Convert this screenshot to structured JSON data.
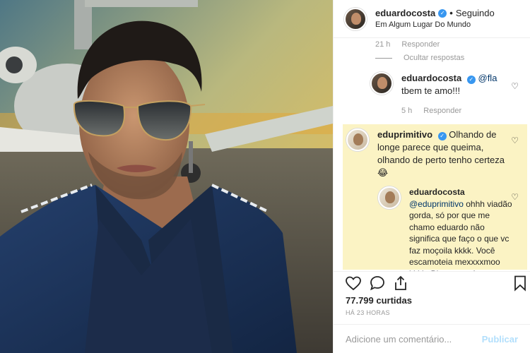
{
  "header": {
    "username": "eduardocosta",
    "follow_status": "Seguindo",
    "location": "Em Algum Lugar Do Mundo"
  },
  "top_meta": {
    "time": "21 h",
    "reply_label": "Responder"
  },
  "hide_replies_label": "Ocultar respostas",
  "reply1": {
    "username": "eduardocosta",
    "mention": "@fla",
    "text": "tbem te amo!!!",
    "time": "5 h",
    "reply_label": "Responder"
  },
  "comment2": {
    "username": "eduprimitivo",
    "text": "Olhando de longe parece que queima, olhando de perto tenho certeza 😂"
  },
  "reply2": {
    "username": "eduardocosta",
    "mention": "@eduprimitivo",
    "text": "ohhh viadão gorda, só por que me chamo eduardo não significa que faço o que vc faz moçoila kkkk. Você escamoteia mexxxxmoo kkkk. Bjuuuu xará"
  },
  "likes": "77.799 curtidas",
  "posted_ago": "HÁ 23 HORAS",
  "add_comment": {
    "placeholder": "Adicione um comentário...",
    "publish_label": "Publicar"
  },
  "colors": {
    "verified": "#3897f0",
    "highlight": "#fbf3c4",
    "publish_disabled": "#b2dffc",
    "meta_gray": "#999999"
  },
  "icons": [
    "heart-icon",
    "comment-icon",
    "share-icon",
    "bookmark-icon",
    "verified-icon"
  ]
}
